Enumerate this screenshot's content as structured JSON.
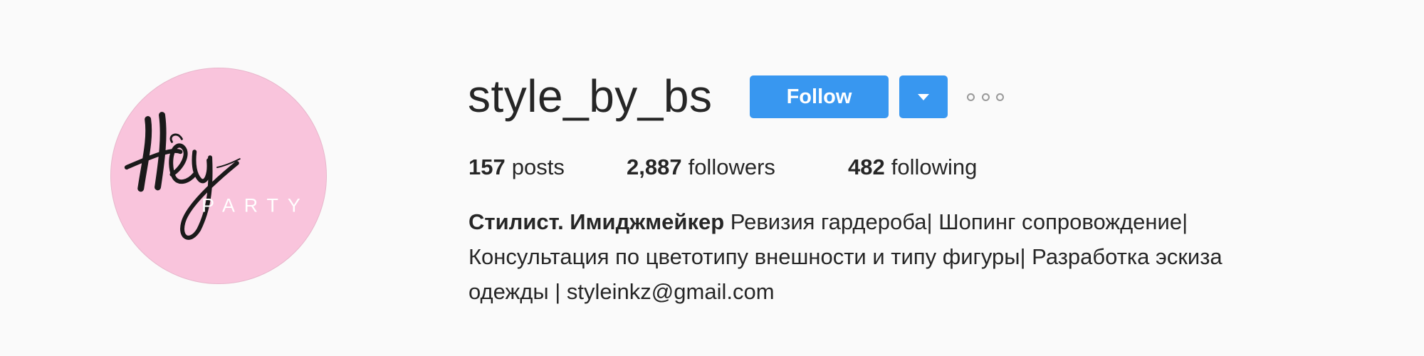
{
  "profile": {
    "username": "style_by_bs",
    "follow_label": "Follow",
    "avatar_icon": "hey-party-logo",
    "avatar_text_script": "Hey",
    "avatar_text_small": "PARTY",
    "avatar_bg_color": "#f9c4dc"
  },
  "stats": {
    "posts_count": "157",
    "posts_label": "posts",
    "followers_count": "2,887",
    "followers_label": "followers",
    "following_count": "482",
    "following_label": "following"
  },
  "bio": {
    "name": "Стилист. Имиджмейкер",
    "line1_rest": " Ревизия гардероба| Шопинг сопровождение|",
    "line2": "Консультация по цветотипу внешности и типу фигуры| Разработка эскиза",
    "line3": "одежды | styleinkz@gmail.com"
  },
  "icons": {
    "dropdown": "chevron-down-icon",
    "more": "more-options-icon"
  },
  "colors": {
    "accent": "#3897f0",
    "background": "#fafafa",
    "text": "#262626"
  }
}
